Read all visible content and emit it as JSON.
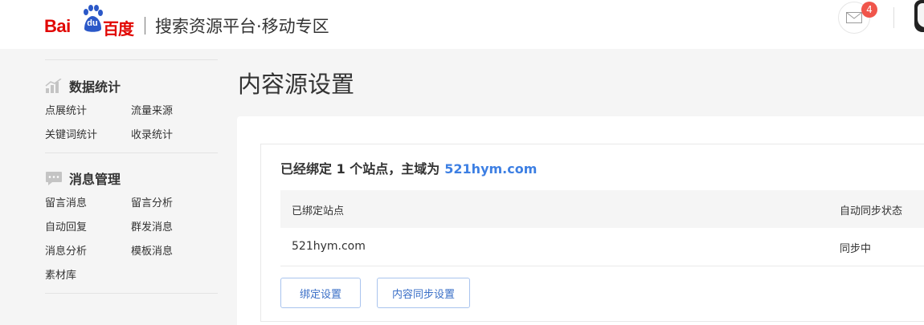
{
  "header": {
    "logo_latin": "Bai",
    "logo_du": "du",
    "logo_cn": "百度",
    "site_title": "搜索资源平台·移动专区",
    "mail_badge": "4",
    "icons": [
      "baidu-paw-logo",
      "mail-icon",
      "avatar"
    ]
  },
  "sidebar": {
    "sections": [
      {
        "title": "数据统计",
        "icon": "bar-chart-icon",
        "links": [
          "点展统计",
          "流量来源",
          "关键词统计",
          "收录统计"
        ]
      },
      {
        "title": "消息管理",
        "icon": "chat-bubble-icon",
        "links": [
          "留言消息",
          "留言分析",
          "自动回复",
          "群发消息",
          "消息分析",
          "模板消息",
          "素材库"
        ]
      }
    ]
  },
  "main": {
    "page_title": "内容源设置",
    "summary": {
      "prefix": "已经绑定 1 个站点，主域为",
      "domain": "521hym.com"
    },
    "table": {
      "headers": [
        "已绑定站点",
        "自动同步状态"
      ],
      "rows": [
        [
          "521hym.com",
          "同步中"
        ]
      ]
    },
    "buttons": {
      "bind_settings": "绑定设置",
      "content_sync_settings": "内容同步设置"
    }
  },
  "colors": {
    "brand_red": "#e10602",
    "link_blue": "#3d7fe3",
    "badge_red": "#f0554b",
    "background": "#f5f5f5"
  }
}
